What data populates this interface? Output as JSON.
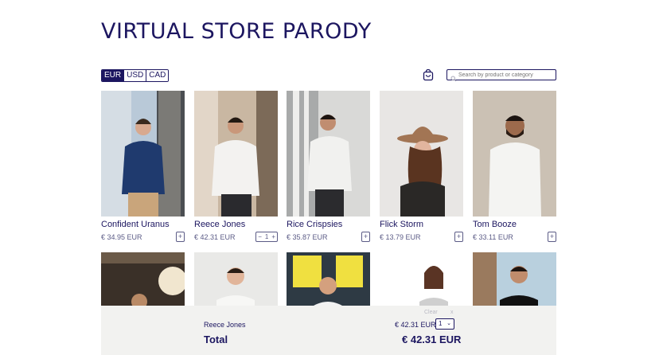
{
  "page": {
    "title": "VIRTUAL STORE PARODY"
  },
  "currencies": {
    "items": [
      "EUR",
      "USD",
      "CAD"
    ],
    "selected": "EUR"
  },
  "search": {
    "placeholder": "Search by product or category"
  },
  "products": [
    {
      "name": "Confident Uranus",
      "price": "€ 34.95 EUR",
      "control": "+"
    },
    {
      "name": "Reece Jones",
      "price": "€ 42.31 EUR",
      "control_minus": "−",
      "control_qty": "1",
      "control_plus": "+"
    },
    {
      "name": "Rice Crispsies",
      "price": "€ 35.87 EUR",
      "control": "+"
    },
    {
      "name": "Flick Storm",
      "price": "€ 13.79 EUR",
      "control": "+"
    },
    {
      "name": "Tom Booze",
      "price": "€ 33.11 EUR",
      "control": "+"
    }
  ],
  "cart": {
    "clear_label": "Clear",
    "clear_x": "x",
    "item_name": "Reece Jones",
    "item_price": "€ 42.31 EUR",
    "item_qty": "1",
    "total_label": "Total",
    "total_value": "€ 42.31 EUR"
  },
  "colors": {
    "primary": "#1c1660",
    "panel": "#f2f2f0"
  }
}
